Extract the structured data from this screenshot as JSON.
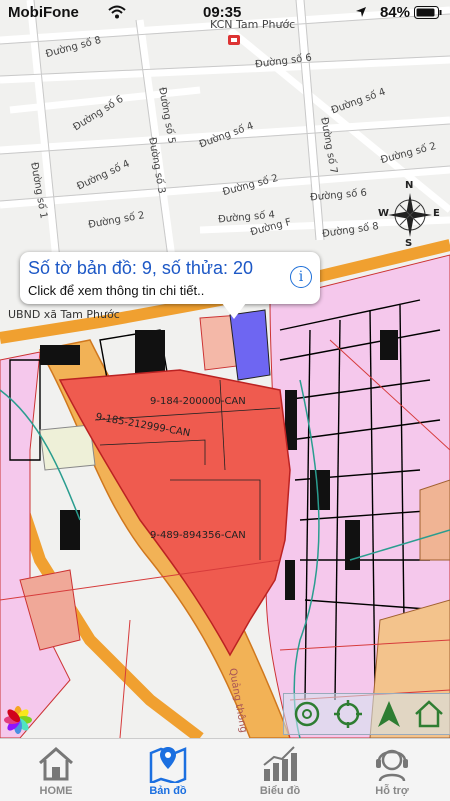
{
  "status": {
    "carrier": "MobiFone",
    "time": "09:35",
    "battery": "84%"
  },
  "map": {
    "places": {
      "kcn": "KCN Tam Phước",
      "ubnd": "UBND xã Tam Phước"
    },
    "roads": [
      "Đường số 8",
      "Đường số 6",
      "Đường số 6",
      "Đường số 5",
      "Đường số 4",
      "Đường số 4",
      "Đường số 4",
      "Đường số 3",
      "Đường số 2",
      "Đường số 2",
      "Đường số 2",
      "Đường số 1",
      "Đường số 4",
      "Đường F",
      "Đường số 7",
      "Đường số 8",
      "Đường số 6",
      "Quảng thông"
    ],
    "parcels": [
      "9-184-200000-CAN",
      "9-185-212999-CAN",
      "9-489-894356-CAN"
    ],
    "compass": {
      "n": "N",
      "e": "E",
      "s": "S",
      "w": "W"
    }
  },
  "popup": {
    "title": "Số tờ bản đồ: 9, số thửa: 20",
    "subtitle": "Click để xem thông tin chi tiết..",
    "info_glyph": "i"
  },
  "tabs": [
    {
      "label": "HOME"
    },
    {
      "label": "Bản đồ"
    },
    {
      "label": "Biểu đồ"
    },
    {
      "label": "Hỗ trợ"
    }
  ]
}
